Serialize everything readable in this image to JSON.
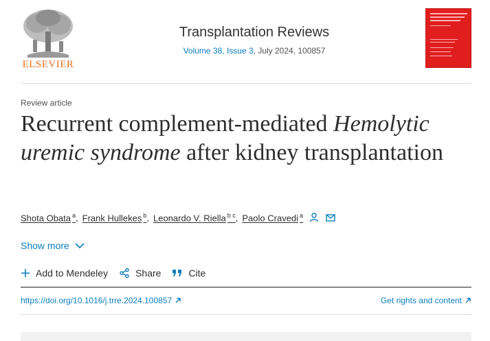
{
  "publisher": {
    "name": "ELSEVIER",
    "logo_icon": "elsevier-tree-logo"
  },
  "journal": {
    "title": "Transplantation Reviews",
    "volume_issue": "Volume 38, Issue 3",
    "date_id": ", July 2024, 100857",
    "cover_icon": "journal-cover-thumbnail",
    "cover_color": "#e01e1e"
  },
  "article": {
    "type": "Review article",
    "title_part1": "Recurrent complement-mediated ",
    "title_italic1": "Hemolytic uremic syndrome",
    "title_part2": " after kidney transplantation"
  },
  "authors": [
    {
      "name": "Shota Obata",
      "aff": "a"
    },
    {
      "name": "Frank Hullekes",
      "aff": "b"
    },
    {
      "name": "Leonardo V. Riella",
      "aff": "b c"
    },
    {
      "name": "Paolo Cravedi",
      "aff": "a"
    }
  ],
  "author_icons": [
    "person-icon",
    "envelope-icon"
  ],
  "show_more": {
    "label": "Show more"
  },
  "actions": {
    "mendeley": "Add to Mendeley",
    "share": "Share",
    "cite": "Cite"
  },
  "links": {
    "doi": "https://doi.org/10.1016/j.trre.2024.100857",
    "rights": "Get rights and content"
  },
  "colors": {
    "link": "#0c7dbb",
    "brand_orange": "#e9711c"
  }
}
